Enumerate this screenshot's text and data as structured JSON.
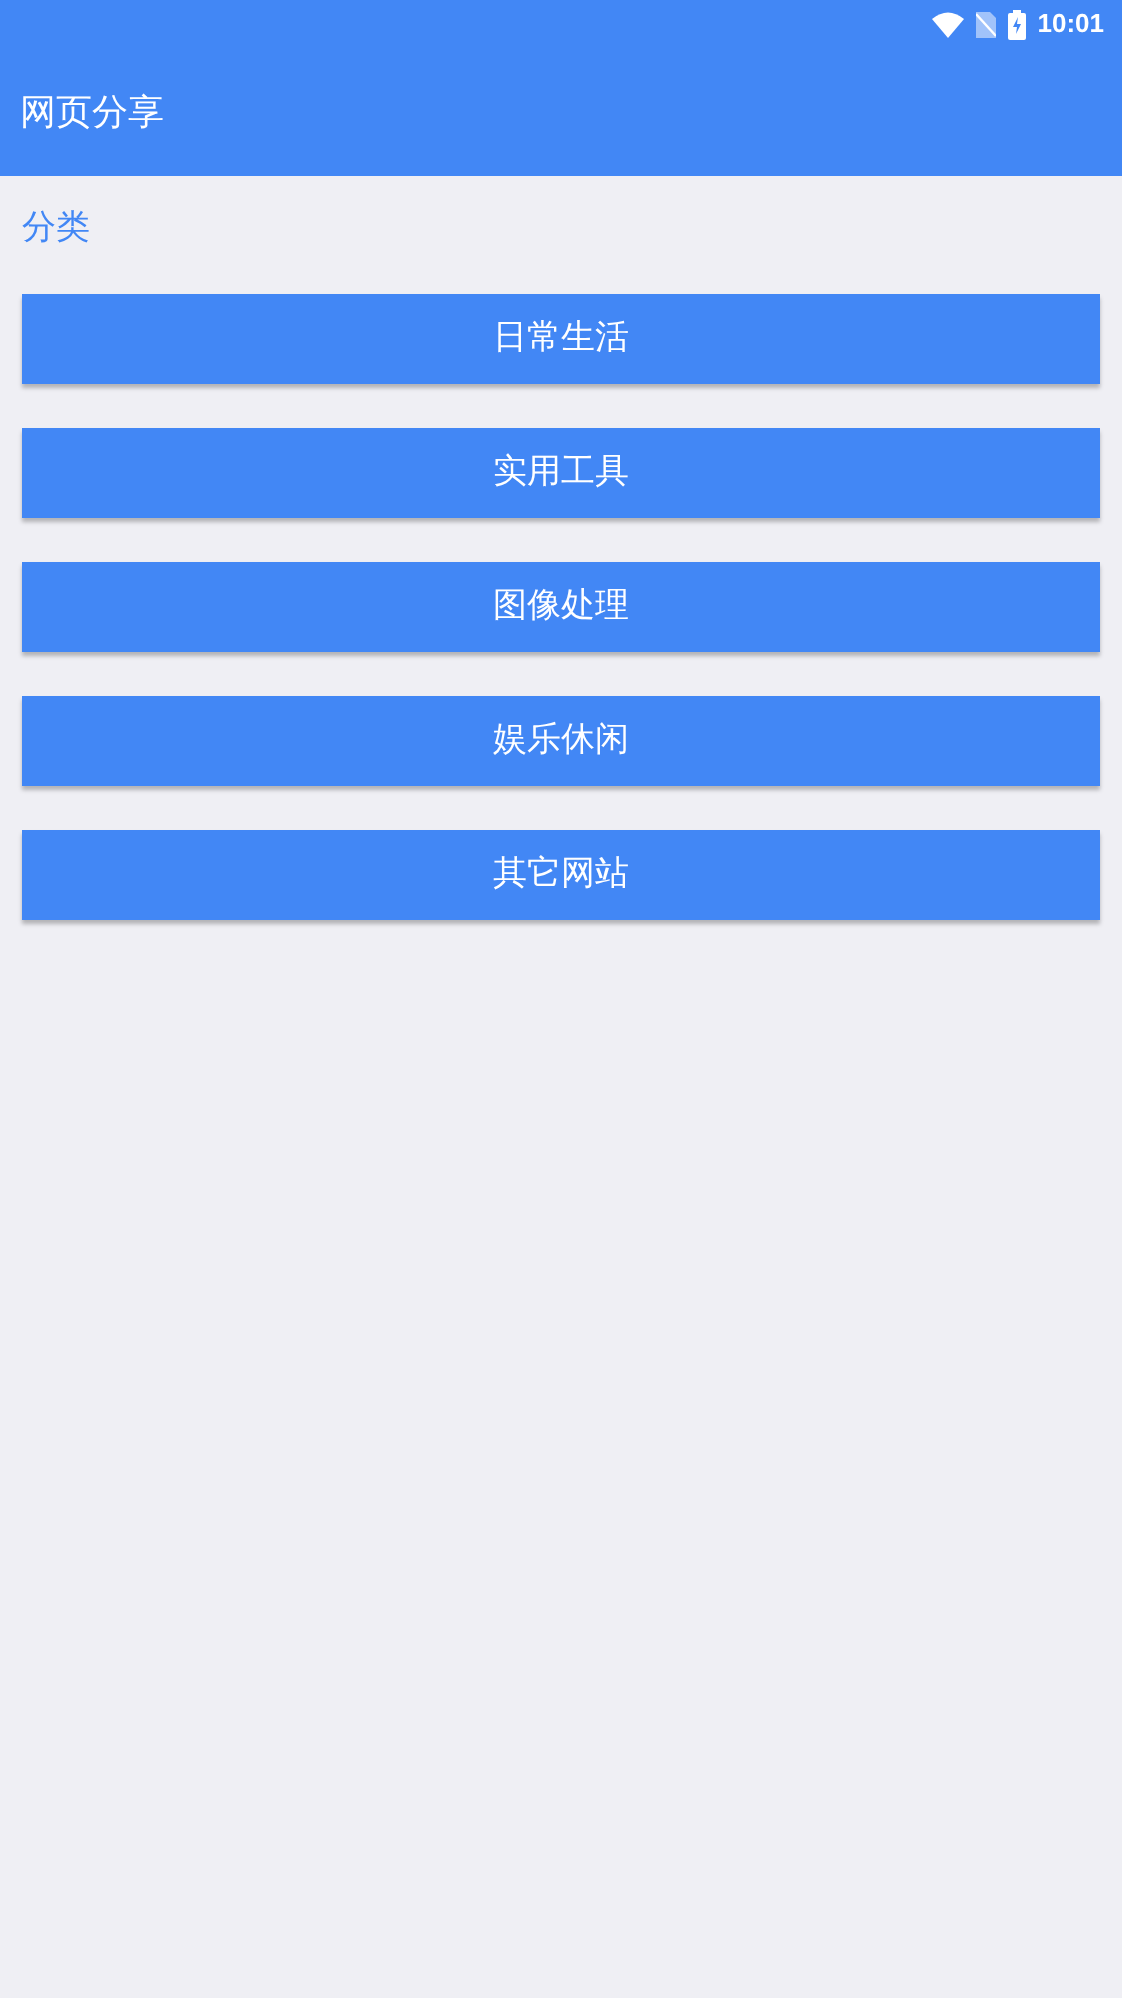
{
  "status_bar": {
    "time": "10:01"
  },
  "app_bar": {
    "title": "网页分享"
  },
  "section": {
    "title": "分类"
  },
  "buttons": [
    {
      "label": "日常生活"
    },
    {
      "label": "实用工具"
    },
    {
      "label": "图像处理"
    },
    {
      "label": "娱乐休闲"
    },
    {
      "label": "其它网站"
    }
  ]
}
